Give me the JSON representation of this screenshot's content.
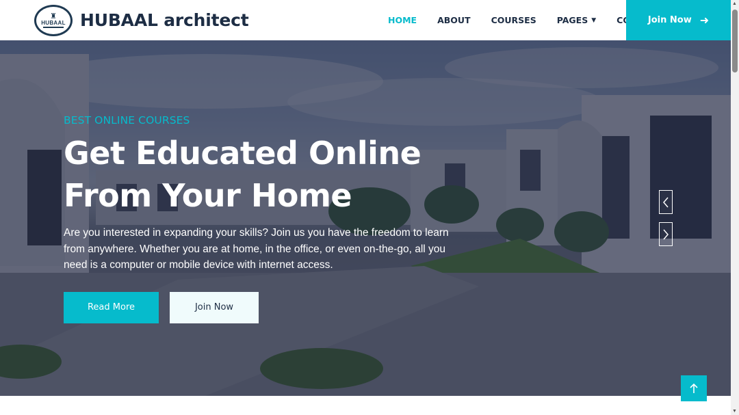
{
  "brand": {
    "logo_text": "HUBAAL",
    "name": "HUBAAL architect"
  },
  "nav": {
    "items": [
      {
        "label": "HOME",
        "active": true
      },
      {
        "label": "ABOUT",
        "active": false
      },
      {
        "label": "COURSES",
        "active": false
      },
      {
        "label": "PAGES",
        "active": false
      },
      {
        "label": "CONTACT",
        "active": false
      }
    ],
    "join_label": "Join Now"
  },
  "hero": {
    "eyebrow": "BEST ONLINE COURSES",
    "headline_line1": "Get Educated Online",
    "headline_line2": "From Your Home",
    "description": "Are you interested in expanding your skills? Join us you have the freedom to learn from anywhere. Whether you are at home, in the office, or even on-the-go, all you need is a computer or mobile device with internet access.",
    "read_more_label": "Read More",
    "join_label": "Join Now"
  },
  "icons": {
    "nav_join": "arrow-right-icon",
    "pages_dropdown": "chevron-down-icon",
    "carousel_prev": "chevron-left-icon",
    "carousel_next": "chevron-right-icon",
    "back_to_top": "arrow-up-icon"
  },
  "colors": {
    "accent": "#06bbcc",
    "dark": "#1d2d44",
    "overlay": "#181d38"
  }
}
